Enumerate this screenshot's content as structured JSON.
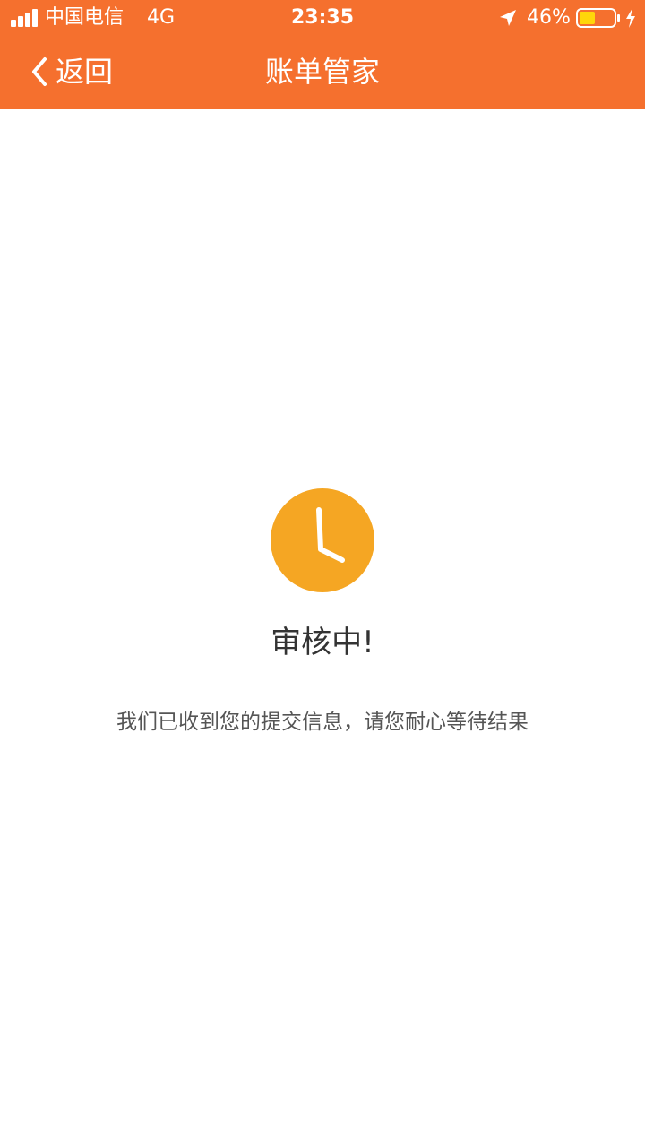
{
  "status_bar": {
    "carrier": "中国电信",
    "network": "4G",
    "time": "23:35",
    "battery_percent_text": "46%",
    "battery_level": 0.46,
    "icons": {
      "signal": "signal-strength-icon",
      "location": "location-arrow-icon",
      "battery": "battery-icon",
      "charging": "charging-bolt-icon"
    }
  },
  "nav": {
    "back_label": "返回",
    "title": "账单管家",
    "back_icon": "chevron-left-icon"
  },
  "content": {
    "status_icon": "clock-icon",
    "status_title": "审核中!",
    "status_message": "我们已收到您的提交信息，请您耐心等待结果"
  },
  "colors": {
    "header_bg": "#f5702e",
    "icon_circle": "#f5a623",
    "battery_fill": "#ffd60a",
    "text_primary": "#333333",
    "text_secondary": "#555555"
  }
}
